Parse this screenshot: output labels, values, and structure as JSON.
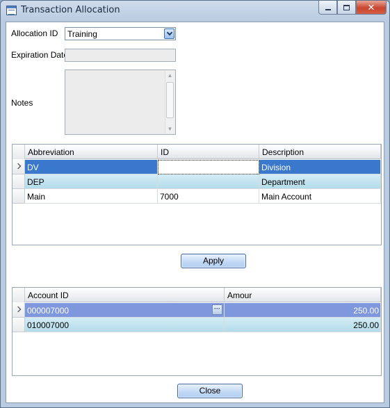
{
  "window": {
    "title": "Transaction Allocation",
    "caption": {
      "minimize": "minimize-icon",
      "maximize": "maximize-icon",
      "close": "✕"
    }
  },
  "form": {
    "allocation_id_label": "Allocation ID",
    "allocation_id_value": "Training",
    "expiration_date_label": "Expiration Date",
    "expiration_date_value": "",
    "notes_label": "Notes",
    "notes_value": ""
  },
  "segments_grid": {
    "columns": [
      "Abbreviation",
      "ID",
      "Description"
    ],
    "rows": [
      {
        "abbreviation": "DV",
        "id": "",
        "description": "Division"
      },
      {
        "abbreviation": "DEP",
        "id": "",
        "description": "Department"
      },
      {
        "abbreviation": "Main",
        "id": "7000",
        "description": "Main Account"
      }
    ]
  },
  "apply_label": "Apply",
  "accounts_grid": {
    "columns": [
      "Account ID",
      "Amour"
    ],
    "rows": [
      {
        "account_id": "000007000",
        "amount": "250.00"
      },
      {
        "account_id": "010007000",
        "amount": "250.00"
      }
    ]
  },
  "close_label": "Close",
  "colors": {
    "selected_row": "#3a78cc",
    "alt_row": "#c3e4f0",
    "selected_row_secondary": "#7f97dc"
  }
}
